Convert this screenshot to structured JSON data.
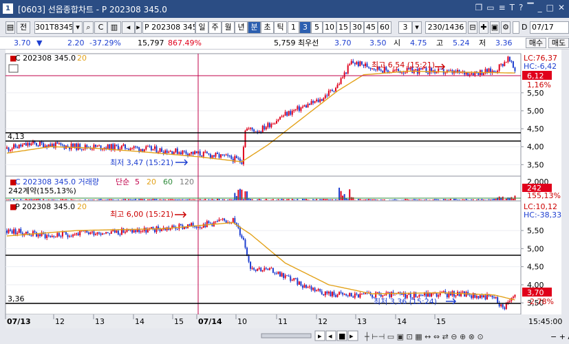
{
  "window": {
    "num": "1",
    "title": "[0603] 선옵종합차트 - P 202308 345.0"
  },
  "toolbar": {
    "jeon": "전",
    "code1": "301T8345",
    "code2": "P 202308 345",
    "periods": [
      "일",
      "주",
      "월",
      "년",
      "분",
      "초",
      "틱"
    ],
    "active_period": "분",
    "mins": [
      "1",
      "3",
      "5",
      "10",
      "15",
      "30",
      "45",
      "60"
    ],
    "active_min": "3",
    "count": "3",
    "range": "230/1436",
    "d_label": "D",
    "date": "07/17",
    "buy": "매수",
    "sell": "매도"
  },
  "quote": {
    "price": "3.70",
    "change": "2.20",
    "change_pct": "-37.29%",
    "volume": "15,797",
    "vol_pct": "867.49%",
    "oi": "5,759",
    "best_label": "최우선",
    "best_ask": "3.70",
    "best_bid": "3.50",
    "open_label": "시",
    "open": "4.75",
    "high_label": "고",
    "high": "5.24",
    "low_label": "저",
    "low": "3.36"
  },
  "colors": {
    "up": "#e0001b",
    "down": "#1d3ed0",
    "ma": "#e3a21a",
    "axis": "#6f7480"
  },
  "icons": [
    "list-icon",
    "menu-icon",
    "window-restore-icon",
    "window-minimize-icon",
    "font-size-icon",
    "help-icon",
    "pin-icon",
    "close-icon"
  ],
  "panel1": {
    "name": "C 202308 345.0",
    "ma": "20",
    "lc": "LC:76,37",
    "hc": "HC:-6,42",
    "price_tag": "6,12",
    "pct_tag": "1,16%",
    "hline_label": "4,13",
    "high_note": "최고 6,54 (15:21)",
    "low_note": "최저 3,47 (15:21)"
  },
  "panel2": {
    "name": "C 202308 345.0 거래량",
    "ma_label": "단순",
    "ma_values": [
      "5",
      "20",
      "60",
      "120"
    ],
    "sub": "242계약(155,13%)",
    "vol_tag": "242",
    "vol_pct_tag": "155,13%"
  },
  "panel3": {
    "name": "P 202308 345.0",
    "ma": "20",
    "lc": "LC:10,12",
    "hc": "HC:-38,33",
    "price_tag": "3,70",
    "pct_tag": "-2,78%",
    "hline_label": "3,36",
    "high_note": "최고 6,00 (15:21)",
    "low_note": "최저 3,36 (15:24)"
  },
  "xaxis": {
    "labels": [
      "07/13",
      "12",
      "13",
      "14",
      "15",
      "07/14",
      "10",
      "11",
      "12",
      "13",
      "14",
      "15"
    ],
    "end": "15:45:00"
  },
  "chart_data": [
    {
      "type": "candlestick",
      "series": "C 202308 345.0",
      "ylim": [
        3.2,
        6.55
      ],
      "yticks": [
        3.5,
        4.0,
        4.5,
        5.0,
        5.5
      ],
      "anchors": [
        [
          0,
          3.95
        ],
        [
          15,
          4.08
        ],
        [
          40,
          4.0
        ],
        [
          70,
          3.98
        ],
        [
          100,
          3.86
        ],
        [
          125,
          3.72
        ],
        [
          135,
          3.6
        ],
        [
          137,
          4.5
        ],
        [
          145,
          4.45
        ],
        [
          160,
          4.9
        ],
        [
          180,
          5.3
        ],
        [
          190,
          5.7
        ],
        [
          198,
          6.35
        ],
        [
          220,
          6.1
        ],
        [
          240,
          6.12
        ],
        [
          260,
          6.05
        ],
        [
          280,
          6.1
        ],
        [
          288,
          6.45
        ],
        [
          292,
          6.12
        ]
      ],
      "ma20_anchors": [
        [
          0,
          3.82
        ],
        [
          25,
          4.0
        ],
        [
          50,
          3.96
        ],
        [
          80,
          3.85
        ],
        [
          110,
          3.72
        ],
        [
          135,
          3.58
        ],
        [
          150,
          4.05
        ],
        [
          170,
          4.8
        ],
        [
          190,
          5.55
        ],
        [
          205,
          6.0
        ],
        [
          230,
          6.1
        ],
        [
          292,
          6.05
        ]
      ]
    },
    {
      "type": "bar",
      "series": "거래량",
      "ylim": [
        0,
        2000
      ],
      "ytick": 2000
    },
    {
      "type": "candlestick",
      "series": "P 202308 345.0",
      "ylim": [
        3.2,
        6.3
      ],
      "yticks": [
        3.5,
        4.0,
        4.5,
        5.0,
        5.5
      ],
      "anchors": [
        [
          0,
          5.5
        ],
        [
          25,
          5.35
        ],
        [
          50,
          5.45
        ],
        [
          80,
          5.5
        ],
        [
          110,
          5.65
        ],
        [
          130,
          5.8
        ],
        [
          136,
          5.25
        ],
        [
          140,
          4.5
        ],
        [
          155,
          4.35
        ],
        [
          170,
          4.0
        ],
        [
          185,
          3.75
        ],
        [
          200,
          3.7
        ],
        [
          230,
          3.72
        ],
        [
          260,
          3.75
        ],
        [
          280,
          3.65
        ],
        [
          285,
          3.36
        ],
        [
          292,
          3.7
        ]
      ],
      "ma20_anchors": [
        [
          0,
          5.35
        ],
        [
          40,
          5.5
        ],
        [
          90,
          5.55
        ],
        [
          130,
          5.72
        ],
        [
          140,
          5.4
        ],
        [
          160,
          4.6
        ],
        [
          185,
          4.0
        ],
        [
          210,
          3.75
        ],
        [
          250,
          3.78
        ],
        [
          280,
          3.72
        ],
        [
          292,
          3.58
        ]
      ]
    }
  ]
}
